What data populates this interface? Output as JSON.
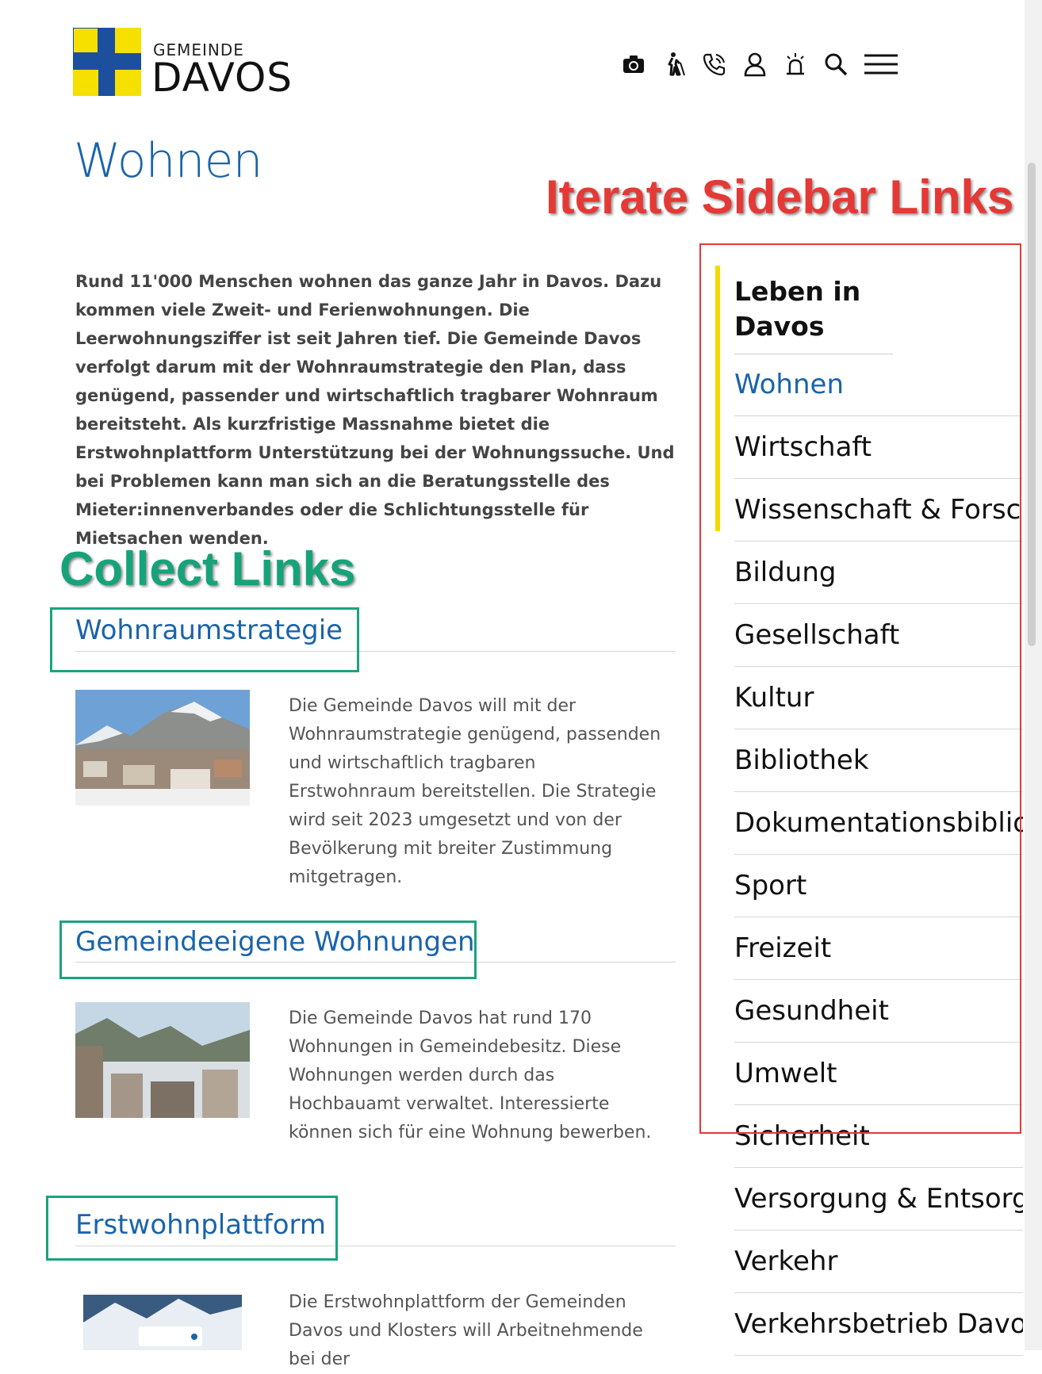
{
  "header": {
    "logo_small": "GEMEINDE",
    "logo_big": "DAVOS",
    "tools": [
      {
        "icon": "camera-icon"
      },
      {
        "icon": "accessibility-icon"
      },
      {
        "icon": "phone-icon"
      },
      {
        "icon": "user-icon"
      },
      {
        "icon": "alarm-icon"
      },
      {
        "icon": "search-icon"
      },
      {
        "icon": "menu-icon"
      }
    ]
  },
  "main": {
    "title": "Wohnen",
    "intro": "Rund 11'000 Menschen wohnen das ganze Jahr in Davos. Dazu kommen viele Zweit- und Ferienwohnungen. Die Leerwohnungsziffer ist seit Jahren tief. Die Gemeinde Davos verfolgt darum mit der Wohnraumstrategie den Plan, dass genügend, passender und wirtschaftlich tragbarer Wohnraum bereitsteht. Als kurzfristige Massnahme bietet die Erstwohnplattform Unterstützung bei der Wohnungssuche. Und bei Problemen kann man sich an die Beratungsstelle des Mieter:innenverbandes oder die Schlichtungsstelle für Mietsachen wenden.",
    "sections": [
      {
        "title": "Wohnraumstrategie",
        "text": "Die Gemeinde Davos will mit der Wohnraumstrategie genügend, passenden und wirtschaftlich tragbaren Erstwohnraum bereitstellen. Die Strategie wird seit 2023 umgesetzt und von der Bevölkerung mit breiter Zustimmung mitgetragen."
      },
      {
        "title": "Gemeindeeigene Wohnungen",
        "text": "Die Gemeinde Davos hat rund 170 Wohnungen in Gemeindebesitz. Diese Wohnungen werden durch das Hochbauamt verwaltet. Interessierte können sich für eine Wohnung bewerben."
      },
      {
        "title": "Erstwohnplattform",
        "text": "Die Erstwohnplattform der Gemeinden Davos und Klosters will Arbeitnehmende bei der"
      }
    ]
  },
  "sidebar": {
    "heading": "Leben in Davos",
    "items": [
      {
        "label": "Wohnen"
      },
      {
        "label": "Wirtschaft"
      },
      {
        "label": "Wissenschaft & Forschung"
      },
      {
        "label": "Bildung"
      },
      {
        "label": "Gesellschaft"
      },
      {
        "label": "Kultur"
      },
      {
        "label": "Bibliothek"
      },
      {
        "label": "Dokumentationsbibliothek"
      },
      {
        "label": "Sport"
      },
      {
        "label": "Freizeit"
      },
      {
        "label": "Gesundheit"
      },
      {
        "label": "Umwelt"
      },
      {
        "label": "Sicherheit"
      },
      {
        "label": "Versorgung & Entsorgung"
      },
      {
        "label": "Verkehr"
      },
      {
        "label": "Verkehrsbetrieb Davos"
      }
    ]
  },
  "annotations": {
    "sidebar_label": "Iterate Sidebar Links",
    "links_label": "Collect Links"
  },
  "colors": {
    "brand_blue": "#1a64ab",
    "flag_yellow": "#f5e000",
    "flag_blue": "#1d4f9f",
    "annotation_red": "#e53935",
    "annotation_green": "#1aa37f"
  }
}
